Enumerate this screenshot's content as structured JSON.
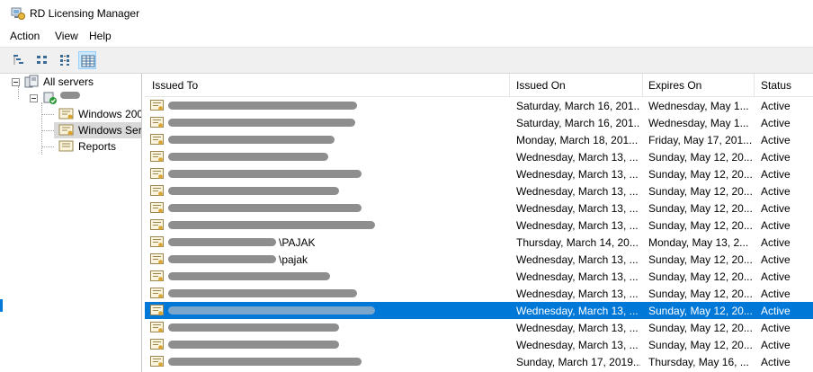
{
  "window": {
    "title": "RD Licensing Manager"
  },
  "menu": {
    "items": [
      "Action",
      "View",
      "Help"
    ]
  },
  "toolbar": {
    "buttons": [
      "large-icons-view",
      "small-icons-view",
      "list-view",
      "details-view"
    ],
    "active": "details-view"
  },
  "tree": {
    "root": "All servers",
    "server": "",
    "children": [
      "Windows 200",
      "Windows Ser",
      "Reports"
    ],
    "selected": "Windows Ser"
  },
  "columns": {
    "issued_to": "Issued To",
    "issued_on": "Issued On",
    "expires_on": "Expires On",
    "status": "Status"
  },
  "rows": [
    {
      "issued_to": "",
      "issued_on": "Saturday, March 16, 201...",
      "expires_on": "Wednesday, May 1...",
      "status": "Active"
    },
    {
      "issued_to": "",
      "issued_on": "Saturday, March 16, 201...",
      "expires_on": "Wednesday, May 1...",
      "status": "Active"
    },
    {
      "issued_to": "",
      "issued_on": "Monday, March 18, 201...",
      "expires_on": "Friday, May 17, 201...",
      "status": "Active"
    },
    {
      "issued_to": "",
      "issued_on": "Wednesday, March 13, ...",
      "expires_on": "Sunday, May 12, 20...",
      "status": "Active"
    },
    {
      "issued_to": "",
      "issued_on": "Wednesday, March 13, ...",
      "expires_on": "Sunday, May 12, 20...",
      "status": "Active"
    },
    {
      "issued_to": "",
      "issued_on": "Wednesday, March 13, ...",
      "expires_on": "Sunday, May 12, 20...",
      "status": "Active"
    },
    {
      "issued_to": "",
      "issued_on": "Wednesday, March 13, ...",
      "expires_on": "Sunday, May 12, 20...",
      "status": "Active"
    },
    {
      "issued_to": "",
      "issued_on": "Wednesday, March 13, ...",
      "expires_on": "Sunday, May 12, 20...",
      "status": "Active"
    },
    {
      "issued_to": "\\PAJAK",
      "issued_on": "Thursday, March 14, 20...",
      "expires_on": "Monday, May 13, 2...",
      "status": "Active"
    },
    {
      "issued_to": "\\pajak",
      "issued_on": "Wednesday, March 13, ...",
      "expires_on": "Sunday, May 12, 20...",
      "status": "Active"
    },
    {
      "issued_to": "",
      "issued_on": "Wednesday, March 13, ...",
      "expires_on": "Sunday, May 12, 20...",
      "status": "Active"
    },
    {
      "issued_to": "",
      "issued_on": "Wednesday, March 13, ...",
      "expires_on": "Sunday, May 12, 20...",
      "status": "Active"
    },
    {
      "issued_to": "",
      "issued_on": "Wednesday, March 13, ...",
      "expires_on": "Sunday, May 12, 20...",
      "status": "Active",
      "selected": true
    },
    {
      "issued_to": "",
      "issued_on": "Wednesday, March 13, ...",
      "expires_on": "Sunday, May 12, 20...",
      "status": "Active"
    },
    {
      "issued_to": "",
      "issued_on": "Wednesday, March 13, ...",
      "expires_on": "Sunday, May 12, 20...",
      "status": "Active"
    },
    {
      "issued_to": "",
      "issued_on": "Sunday, March 17, 2019...",
      "expires_on": "Thursday, May 16, ...",
      "status": "Active"
    }
  ],
  "colors": {
    "selection": "#0078d7",
    "header_border": "#e5e5e5",
    "tree_selection": "#d9d9d9"
  }
}
